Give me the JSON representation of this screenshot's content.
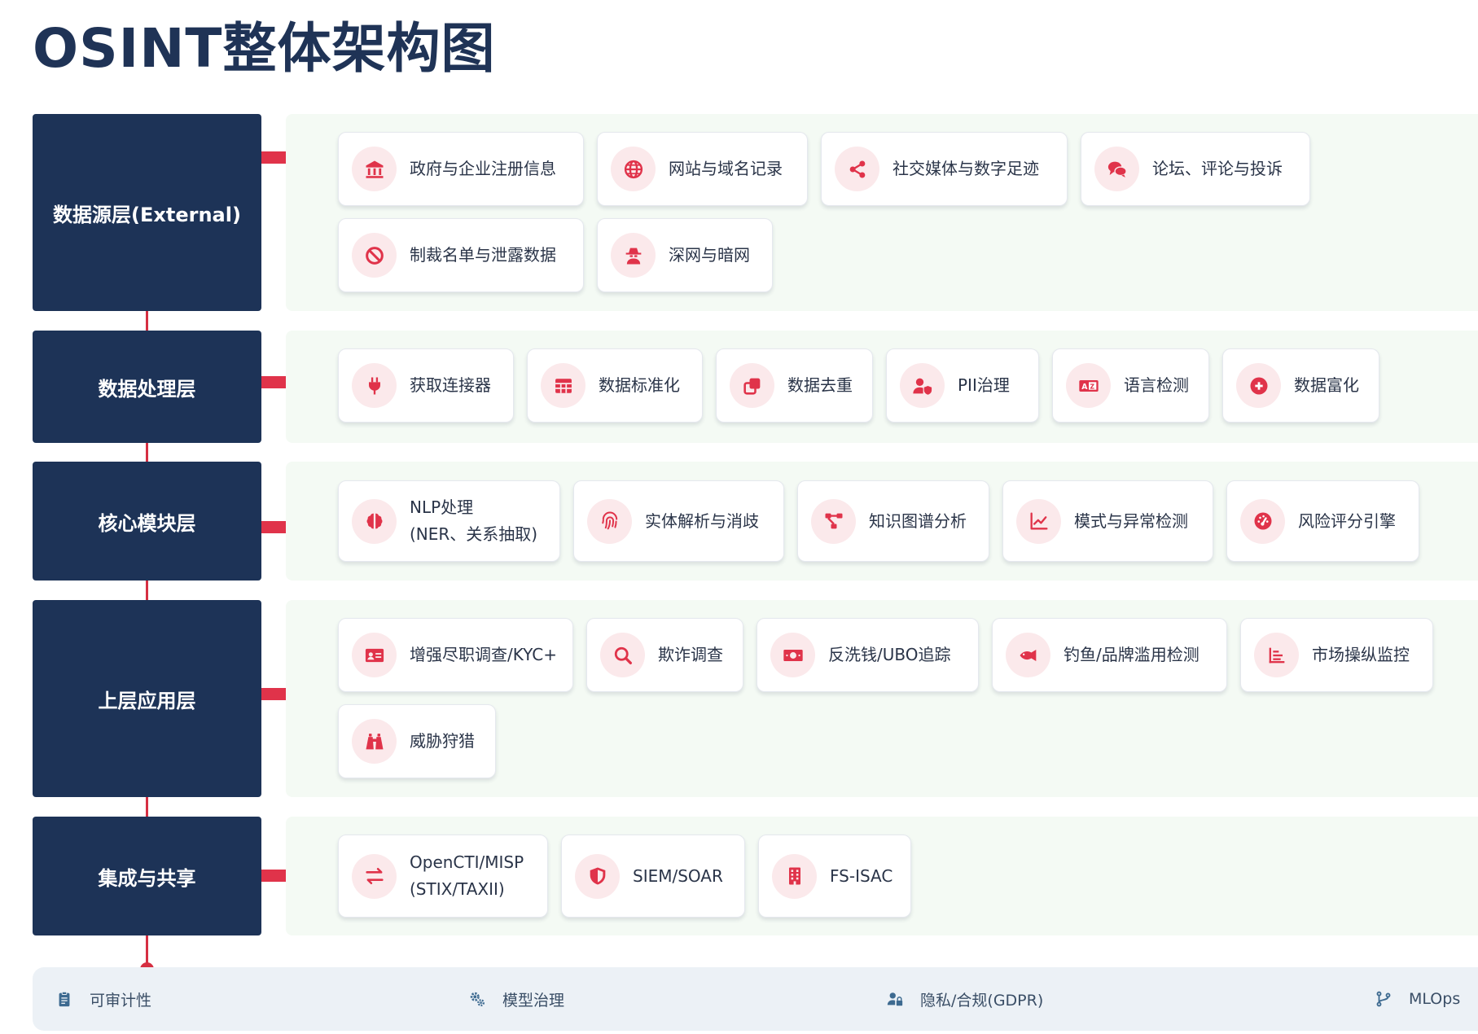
{
  "title": "OSINT整体架构图",
  "colors": {
    "layer_bg": "#1d3357",
    "accent": "#e0334a",
    "panel_bg": "#f4faf4",
    "icon_bg": "#fbe9eb",
    "footer_bg": "#ecf1f6",
    "footer_icon": "#3d6a90"
  },
  "layers": [
    {
      "label": "数据源层(External)",
      "items": [
        {
          "label": "政府与企业注册信息",
          "icon": "landmark-icon"
        },
        {
          "label": "网站与域名记录",
          "icon": "globe-icon"
        },
        {
          "label": "社交媒体与数字足迹",
          "icon": "share-icon"
        },
        {
          "label": "论坛、评论与投诉",
          "icon": "chat-bubbles-icon"
        },
        {
          "label": "制裁名单与泄露数据",
          "icon": "ban-icon"
        },
        {
          "label": "深网与暗网",
          "icon": "user-secret-icon"
        }
      ]
    },
    {
      "label": "数据处理层",
      "items": [
        {
          "label": "获取连接器",
          "icon": "plug-icon"
        },
        {
          "label": "数据标准化",
          "icon": "table-icon"
        },
        {
          "label": "数据去重",
          "icon": "clone-icon"
        },
        {
          "label": "PII治理",
          "icon": "user-shield-icon"
        },
        {
          "label": "语言检测",
          "icon": "language-icon"
        },
        {
          "label": "数据富化",
          "icon": "plus-circle-icon"
        }
      ]
    },
    {
      "label": "核心模块层",
      "items": [
        {
          "label": "NLP处理\n(NER、关系抽取)",
          "icon": "brain-icon"
        },
        {
          "label": "实体解析与消歧",
          "icon": "fingerprint-icon"
        },
        {
          "label": "知识图谱分析",
          "icon": "diagram-project-icon"
        },
        {
          "label": "模式与异常检测",
          "icon": "line-chart-icon"
        },
        {
          "label": "风险评分引擎",
          "icon": "gauge-icon"
        }
      ]
    },
    {
      "label": "上层应用层",
      "items": [
        {
          "label": "增强尽职调查/KYC+",
          "icon": "id-card-icon"
        },
        {
          "label": "欺诈调查",
          "icon": "search-icon"
        },
        {
          "label": "反洗钱/UBO追踪",
          "icon": "money-bill-icon"
        },
        {
          "label": "钓鱼/品牌滥用检测",
          "icon": "fish-icon"
        },
        {
          "label": "市场操纵监控",
          "icon": "bar-chart-icon"
        },
        {
          "label": "威胁狩猎",
          "icon": "binoculars-icon"
        }
      ]
    },
    {
      "label": "集成与共享",
      "items": [
        {
          "label": "OpenCTI/MISP\n(STIX/TAXII)",
          "icon": "exchange-icon"
        },
        {
          "label": "SIEM/SOAR",
          "icon": "shield-icon"
        },
        {
          "label": "FS-ISAC",
          "icon": "building-icon"
        }
      ]
    }
  ],
  "footer": [
    {
      "label": "可审计性",
      "icon": "clipboard-icon"
    },
    {
      "label": "模型治理",
      "icon": "gears-icon"
    },
    {
      "label": "隐私/合规(GDPR)",
      "icon": "user-lock-icon"
    },
    {
      "label": "MLOps",
      "icon": "code-branch-icon"
    }
  ]
}
